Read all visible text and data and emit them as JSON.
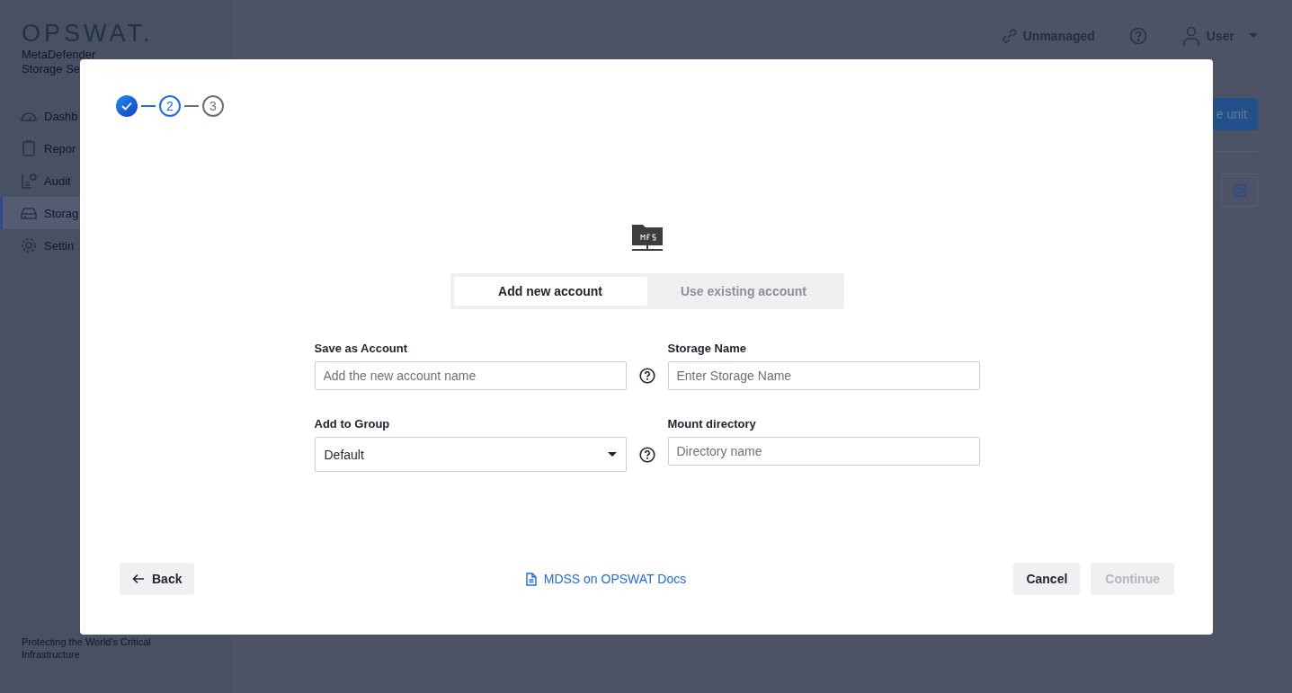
{
  "sidebar": {
    "logo": "OPSWAT.",
    "product_lines": [
      "MetaDefender",
      "Storage Se"
    ],
    "items": [
      {
        "label": "Dashb",
        "selected": false
      },
      {
        "label": "Repor",
        "selected": false
      },
      {
        "label": "Audit",
        "selected": false
      },
      {
        "label": "Storag",
        "selected": true
      },
      {
        "label": "Settin",
        "selected": false
      }
    ],
    "footer": "Protecting the World's Critical Infrastructure"
  },
  "header": {
    "status": "Unmanaged",
    "user": "User"
  },
  "main": {
    "primary_button": "e unit"
  },
  "dialog": {
    "steps": [
      {
        "kind": "done"
      },
      {
        "label": "2",
        "kind": "current"
      },
      {
        "label": "3",
        "kind": "pending"
      }
    ],
    "tabs": [
      {
        "label": "Add new account",
        "selected": true
      },
      {
        "label": "Use existing account",
        "selected": false
      }
    ],
    "fields": [
      {
        "kind": "text",
        "label": "Save as Account",
        "placeholder": "Add the new account name",
        "help": true
      },
      {
        "kind": "text",
        "label": "Storage Name",
        "placeholder": "Enter Storage Name",
        "help": false
      },
      {
        "kind": "select",
        "label": "Add to Group",
        "value": "Default",
        "help": true
      },
      {
        "kind": "text",
        "label": "Mount directory",
        "placeholder": "Directory name",
        "help": false
      }
    ],
    "back": "Back",
    "docs_link": "MDSS on OPSWAT Docs",
    "cancel": "Cancel",
    "continue": {
      "label": "Continue",
      "disabled": true
    }
  }
}
